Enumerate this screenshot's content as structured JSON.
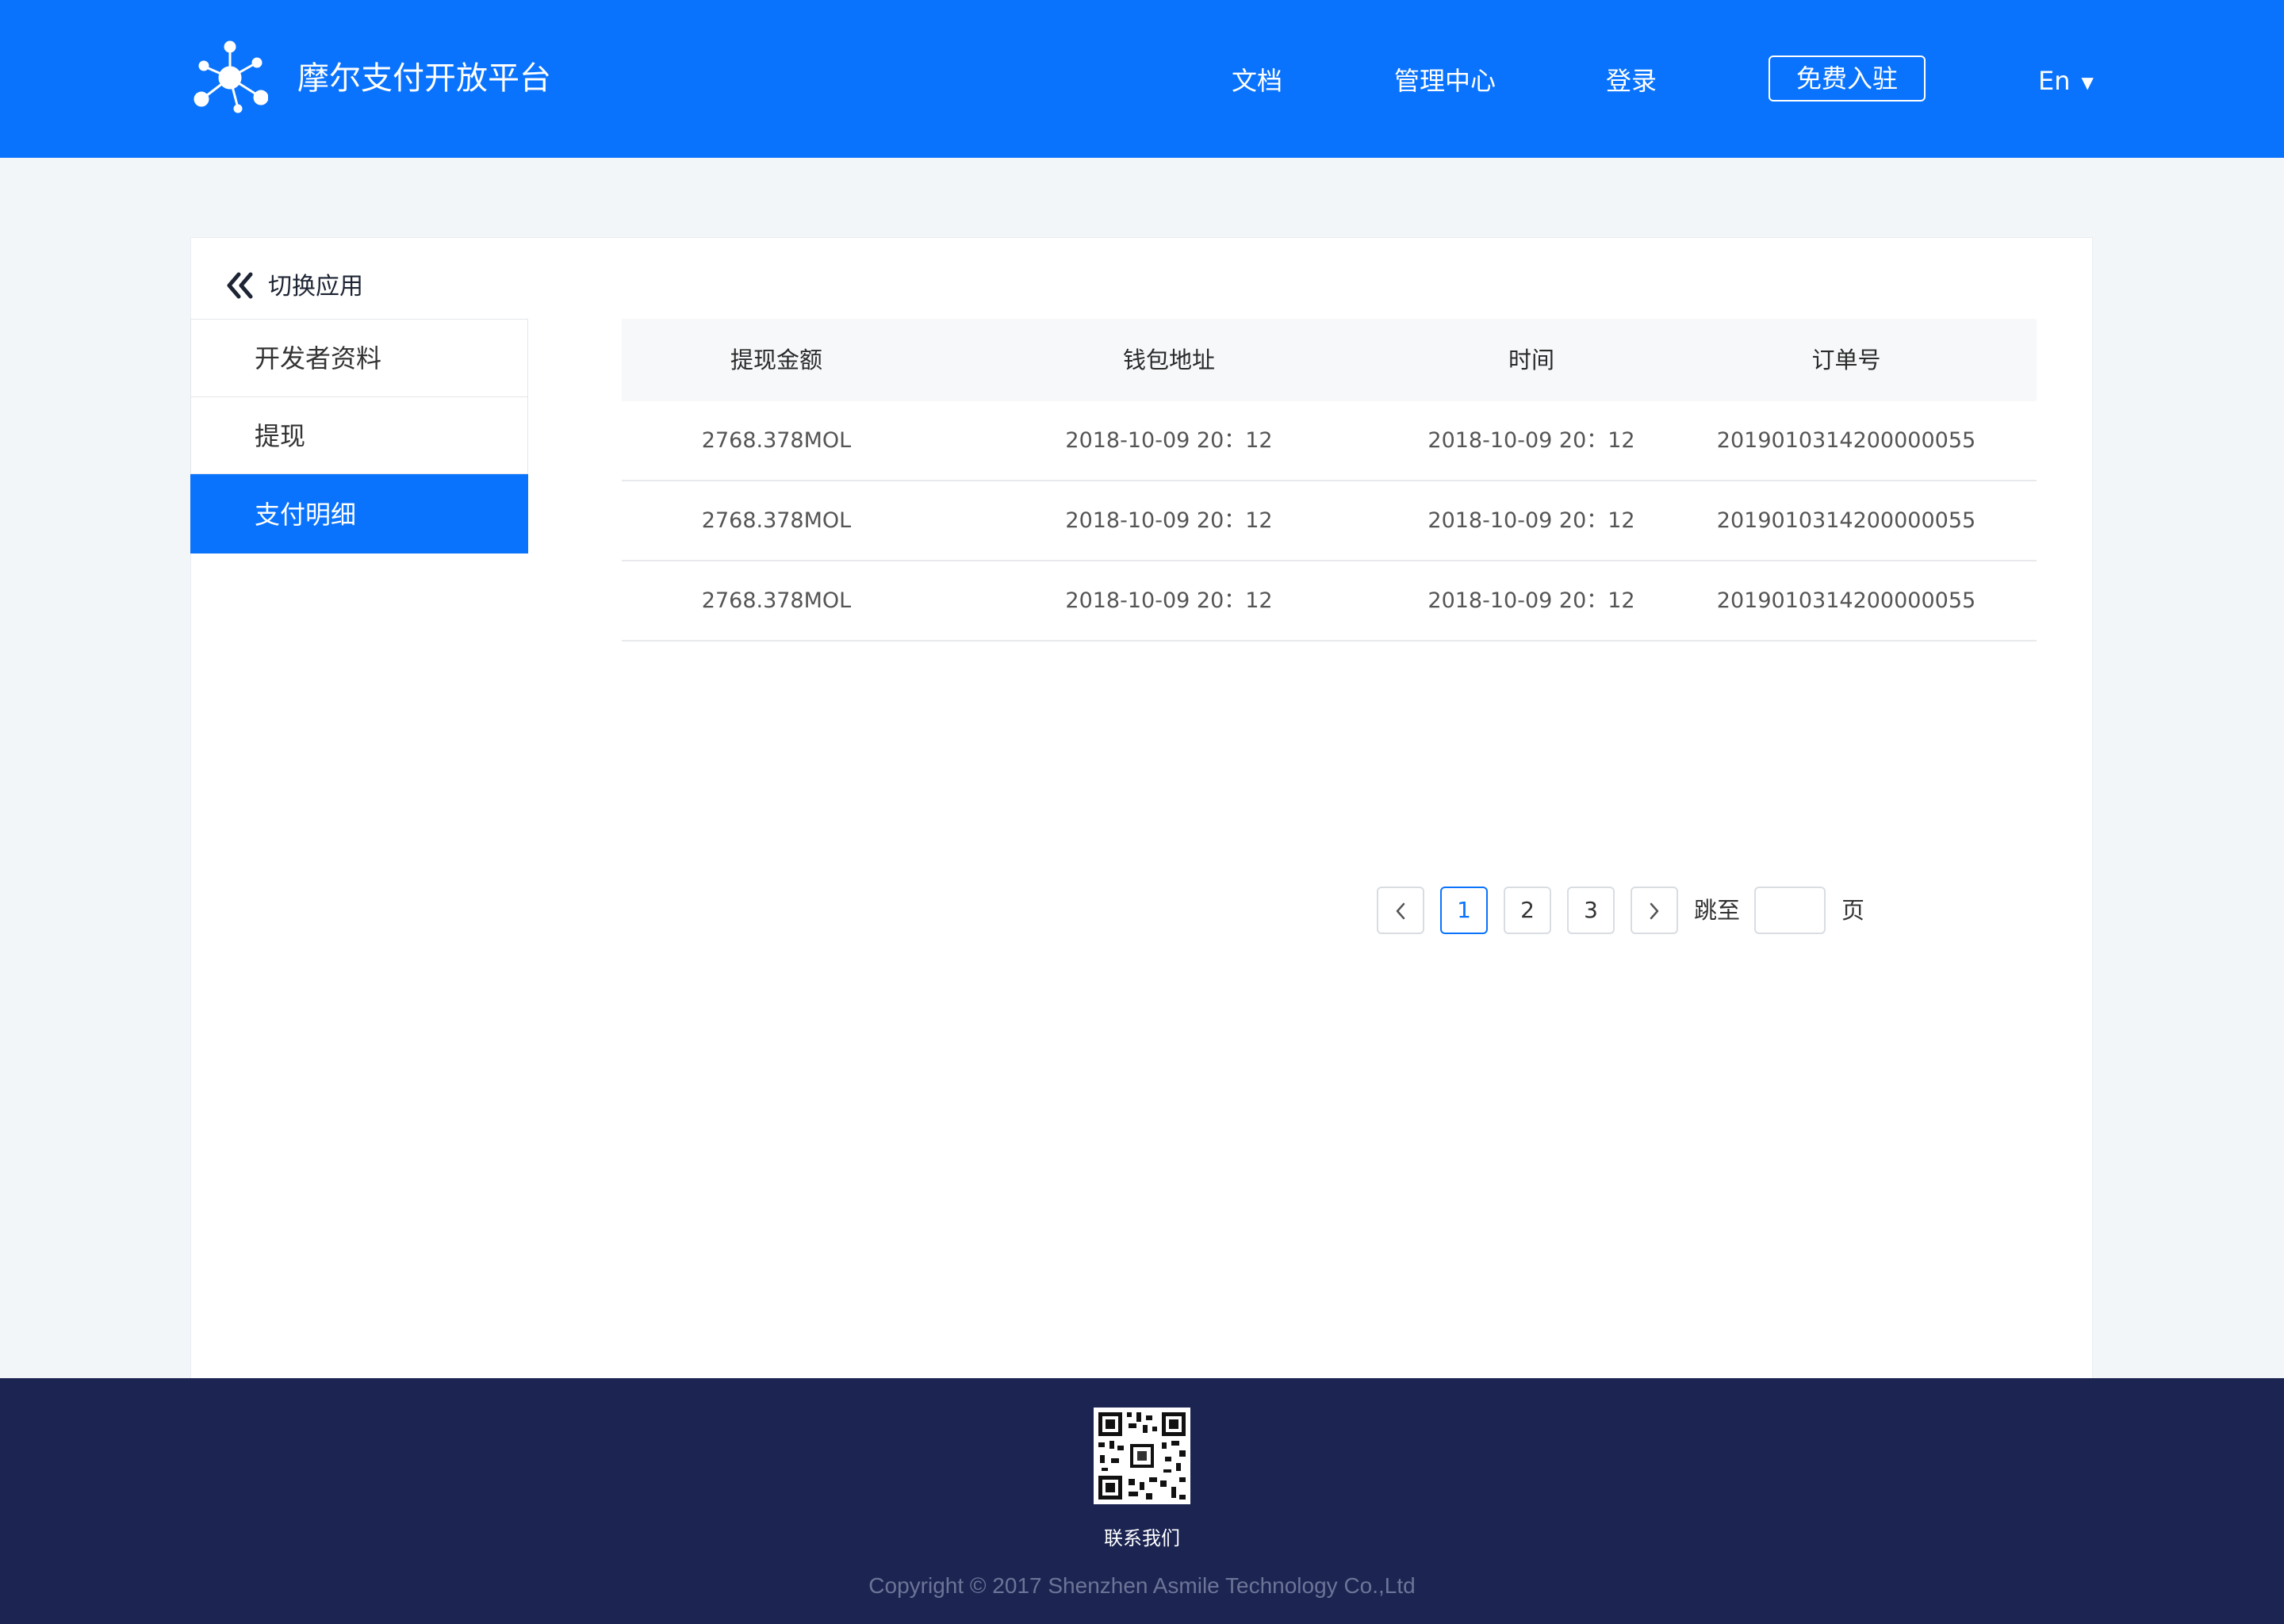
{
  "header": {
    "brand": "摩尔支付开放平台",
    "nav": {
      "docs": "文档",
      "admin": "管理中心",
      "login": "登录",
      "signup": "免费入驻",
      "lang": "En"
    }
  },
  "sidebar": {
    "switch_app": "切换应用",
    "items": [
      {
        "label": "开发者资料"
      },
      {
        "label": "提现"
      },
      {
        "label": "支付明细",
        "active": true
      }
    ]
  },
  "table": {
    "columns": [
      "提现金额",
      "钱包地址",
      "时间",
      "订单号"
    ],
    "rows": [
      [
        "2768.378MOL",
        "2018-10-09  20：12",
        "2018-10-09  20：12",
        "2019010314200000055"
      ],
      [
        "2768.378MOL",
        "2018-10-09  20：12",
        "2018-10-09  20：12",
        "2019010314200000055"
      ],
      [
        "2768.378MOL",
        "2018-10-09  20：12",
        "2018-10-09  20：12",
        "2019010314200000055"
      ]
    ]
  },
  "pagination": {
    "pages": [
      "1",
      "2",
      "3"
    ],
    "current": "1",
    "jump_label": "跳至",
    "page_suffix": "页",
    "jump_value": ""
  },
  "footer": {
    "contact": "联系我们",
    "copyright": "Copyright © 2017 Shenzhen Asmile Technology Co.,Ltd"
  },
  "colors": {
    "primary": "#0a73fd",
    "footer_bg": "#1c2452",
    "page_bg": "#f3f6f8"
  }
}
